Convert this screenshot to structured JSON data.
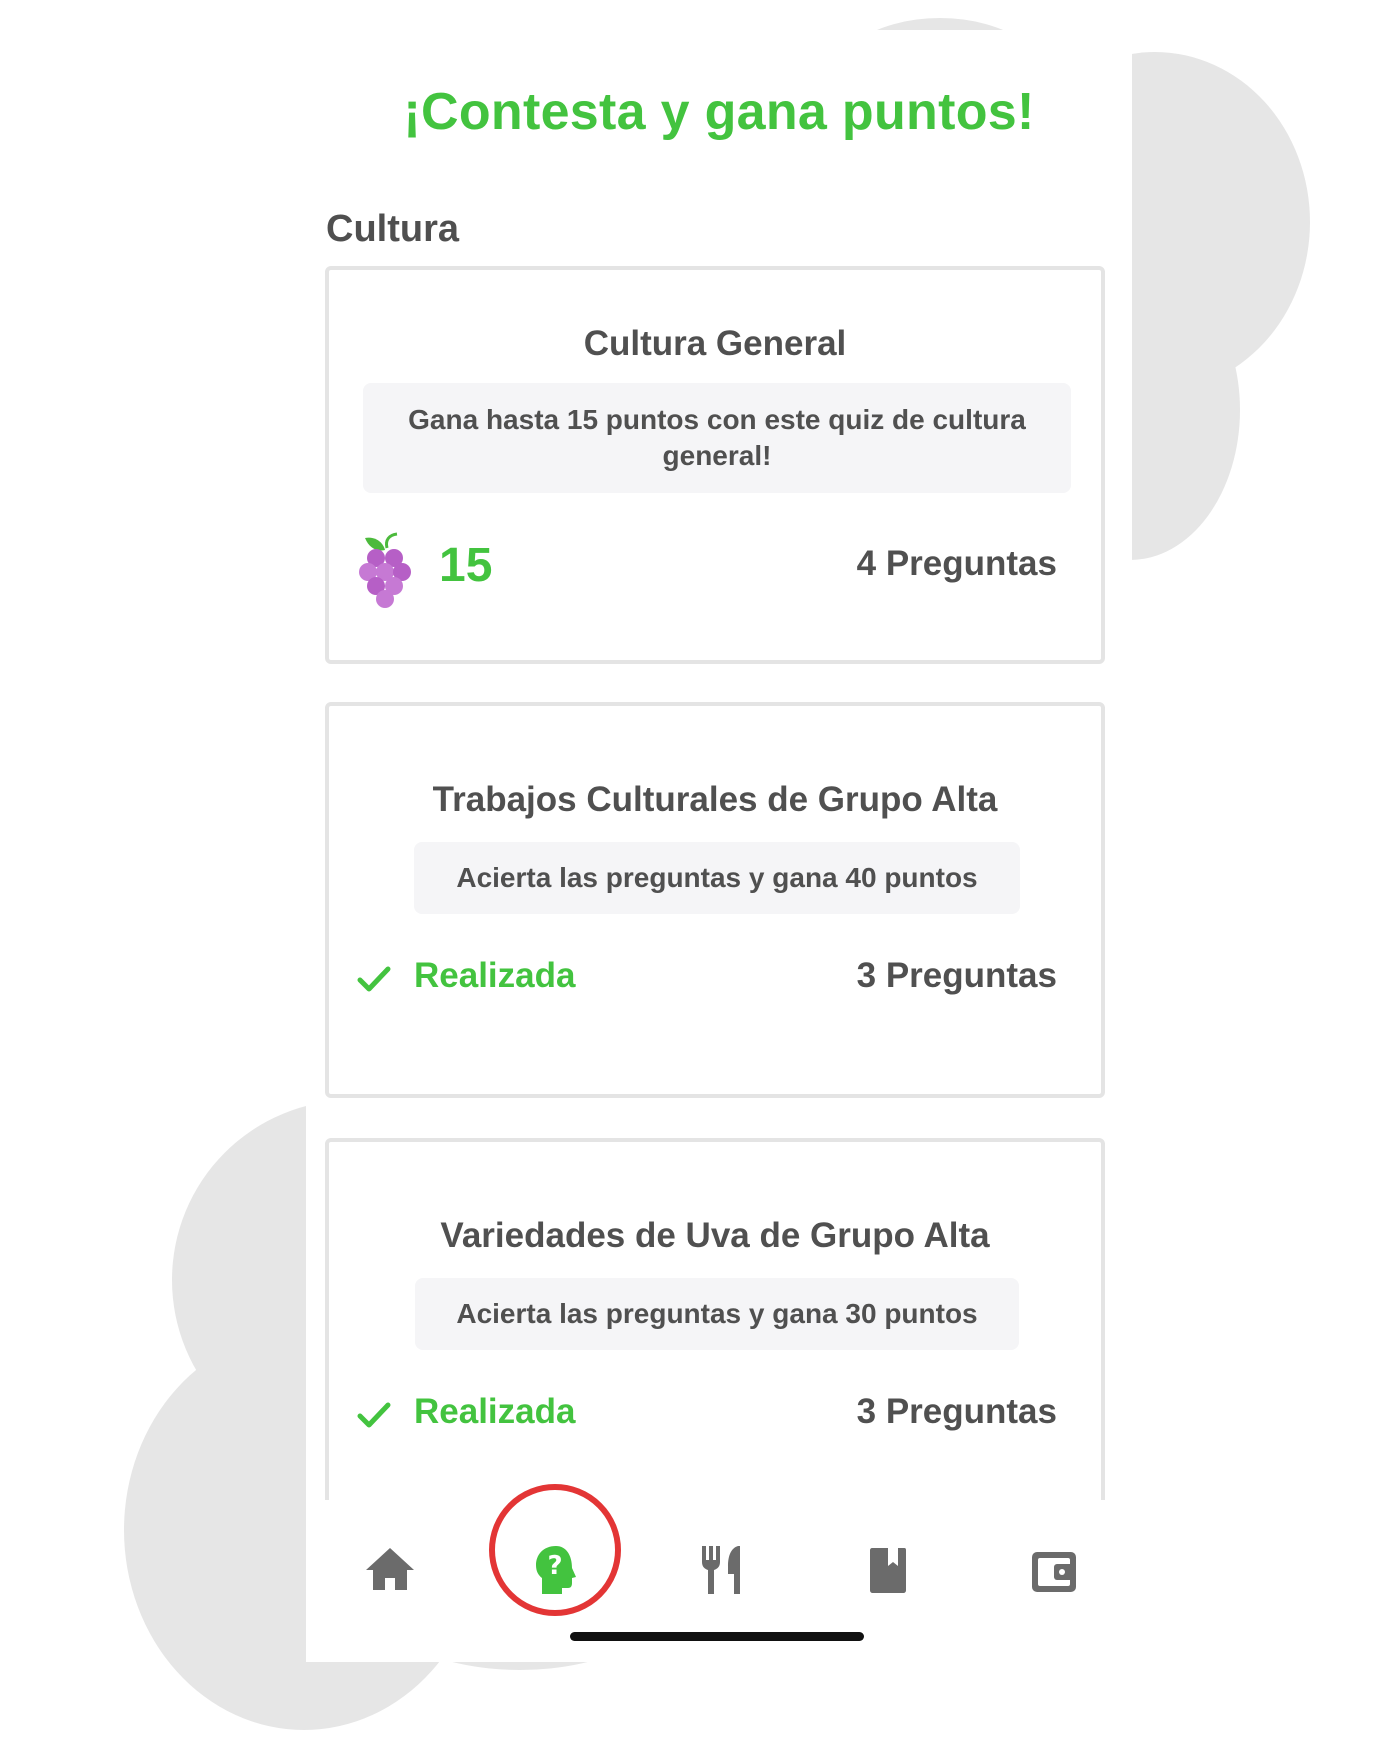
{
  "header": {
    "title": "¡Contesta y gana puntos!"
  },
  "section": {
    "title": "Cultura"
  },
  "cards": [
    {
      "title": "Cultura General",
      "description": "Gana hasta 15 puntos con este quiz de cultura general!",
      "points": "15",
      "reward_icon": "grapes-icon",
      "questions": "4 Preguntas"
    },
    {
      "title": "Trabajos Culturales de Grupo Alta",
      "description": "Acierta las preguntas y gana 40 puntos",
      "status": "Realizada",
      "questions": "3 Preguntas"
    },
    {
      "title": "Variedades de Uva de Grupo Alta",
      "description": "Acierta las preguntas y gana 30 puntos",
      "status": "Realizada",
      "questions": "3 Preguntas"
    }
  ],
  "tabbar": {
    "items": [
      {
        "icon": "home-icon",
        "active": false
      },
      {
        "icon": "quiz-head-icon",
        "active": true
      },
      {
        "icon": "restaurant-icon",
        "active": false
      },
      {
        "icon": "book-icon",
        "active": false
      },
      {
        "icon": "wallet-icon",
        "active": false
      }
    ]
  },
  "colors": {
    "accent": "#43c33f",
    "text": "#505050",
    "icon_inactive": "#6b6b6b",
    "highlight_ring": "#e33535",
    "background_blob": "#e6e6e6"
  }
}
